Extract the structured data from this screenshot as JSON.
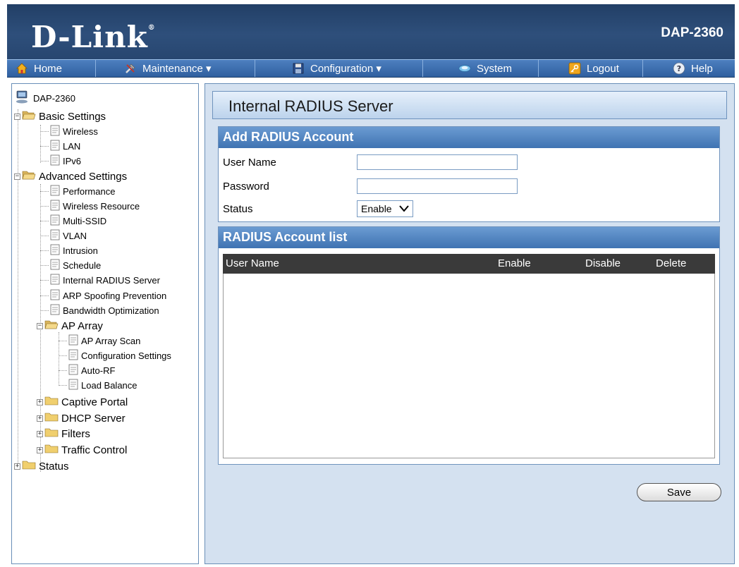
{
  "header": {
    "logo_text": "D-Link",
    "logo_mark": "®",
    "model": "DAP-2360"
  },
  "menu": {
    "items": [
      {
        "label": "Home",
        "icon": "home-icon"
      },
      {
        "label": "Maintenance ▾",
        "icon": "tools-icon"
      },
      {
        "label": "Configuration ▾",
        "icon": "save-icon"
      },
      {
        "label": "System",
        "icon": "system-icon"
      },
      {
        "label": "Logout",
        "icon": "key-icon"
      },
      {
        "label": "Help",
        "icon": "help-icon"
      }
    ]
  },
  "tree": {
    "root": "DAP-2360",
    "basic": {
      "label": "Basic Settings",
      "children": [
        "Wireless",
        "LAN",
        "IPv6"
      ]
    },
    "advanced": {
      "label": "Advanced Settings",
      "children": [
        "Performance",
        "Wireless Resource",
        "Multi-SSID",
        "VLAN",
        "Intrusion",
        "Schedule",
        "Internal RADIUS Server",
        "ARP Spoofing Prevention",
        "Bandwidth Optimization"
      ],
      "ap_array": {
        "label": "AP Array",
        "children": [
          "AP Array Scan",
          "Configuration Settings",
          "Auto-RF",
          "Load Balance"
        ]
      },
      "collapsed": [
        "Captive Portal",
        "DHCP Server",
        "Filters",
        "Traffic Control"
      ]
    },
    "status": "Status"
  },
  "content": {
    "page_title": "Internal RADIUS Server",
    "add_section": {
      "title": "Add RADIUS Account",
      "user_name_label": "User Name",
      "user_name_value": "",
      "password_label": "Password",
      "password_value": "",
      "status_label": "Status",
      "status_value": "Enable"
    },
    "list_section": {
      "title": "RADIUS Account list",
      "columns": [
        "User Name",
        "Enable",
        "Disable",
        "Delete"
      ],
      "rows": []
    },
    "save_label": "Save"
  },
  "colors": {
    "header_bg": "#2e4f7b",
    "menu_bg": "#3f6fae",
    "section_head": "#4f82c0",
    "list_header": "#3a3a3a"
  }
}
